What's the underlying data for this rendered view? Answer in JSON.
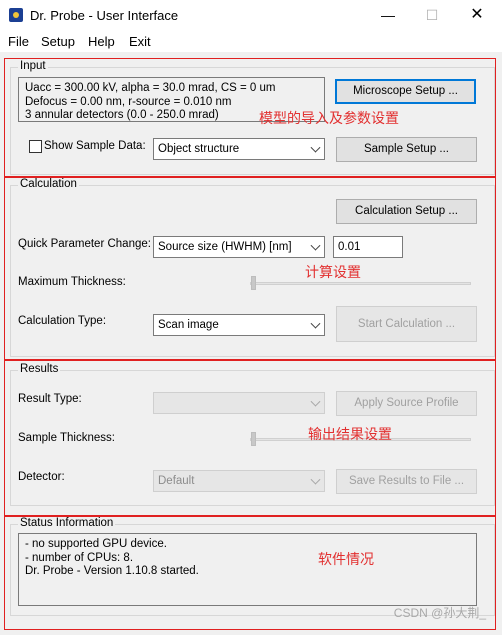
{
  "window": {
    "title": "Dr. Probe - User Interface",
    "min_glyph": "—",
    "max_glyph": "☐",
    "close_glyph": "✕"
  },
  "menu": [
    "File",
    "Setup",
    "Help",
    "Exit"
  ],
  "input": {
    "title": "Input",
    "info_lines": [
      "Uacc = 300.00 kV,  alpha = 30.0 mrad, CS = 0 um",
      "Defocus = 0.00 nm,  r-source = 0.010 nm",
      "3 annular detectors (0.0 - 250.0 mrad)"
    ],
    "microscope_setup_label": "Microscope Setup ...",
    "show_sample_label": "Show Sample Data:",
    "sample_select_value": "Object structure",
    "sample_setup_label": "Sample Setup ...",
    "annotation": "模型的导入及参数设置"
  },
  "calculation": {
    "title": "Calculation",
    "calc_setup_label": "Calculation Setup ...",
    "quick_param_label": "Quick Parameter Change:",
    "quick_param_select": "Source size (HWHM) [nm]",
    "quick_param_value": "0.01",
    "max_thickness_label": "Maximum Thickness:",
    "max_thickness_level": 0,
    "calc_type_label": "Calculation Type:",
    "calc_type_select": "Scan image",
    "start_label": "Start Calculation ...",
    "annotation": "计算设置"
  },
  "results": {
    "title": "Results",
    "result_type_label": "Result Type:",
    "result_type_select": "",
    "apply_source_label": "Apply Source Profile",
    "sample_thickness_label": "Sample Thickness:",
    "sample_thickness_level": 0,
    "detector_label": "Detector:",
    "detector_select": "Default",
    "save_results_label": "Save Results to File ...",
    "annotation": "输出结果设置"
  },
  "status": {
    "title": "Status Information",
    "lines": [
      "- no supported GPU device.",
      "- number of CPUs: 8.",
      "Dr. Probe - Version 1.10.8 started."
    ],
    "annotation": "软件情况"
  },
  "watermark": "CSDN @孙大荆_",
  "colors": {
    "annotation": "#e23030",
    "accent_border": "#0078d7",
    "window_bg": "#f0f0f0"
  }
}
